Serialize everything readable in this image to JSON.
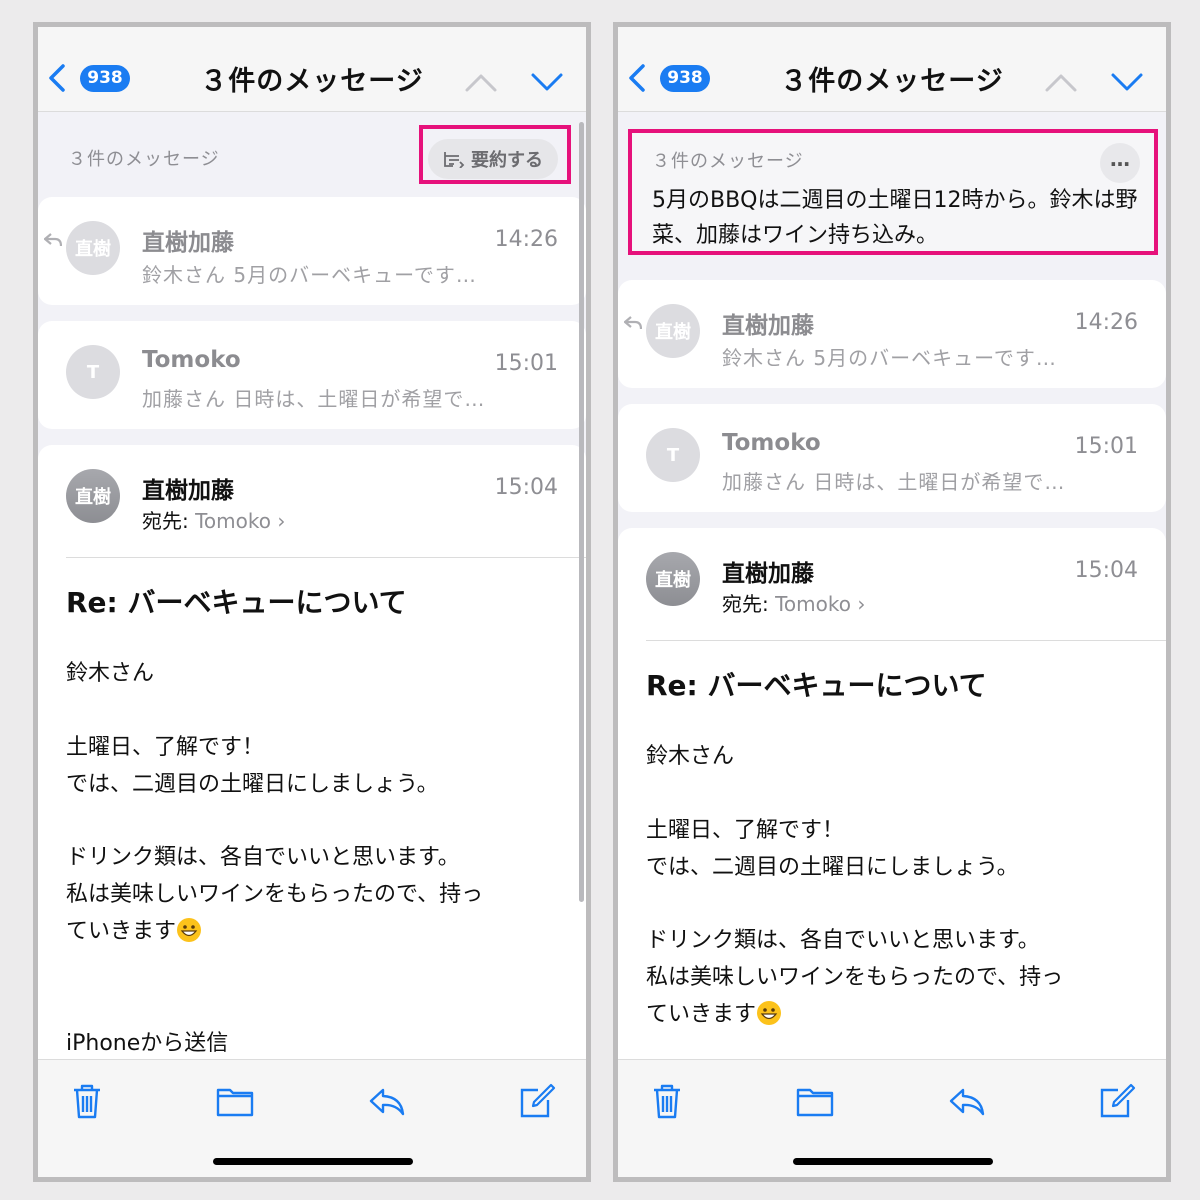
{
  "colors": {
    "accent": "#1a7cf2",
    "highlight": "#e6117b"
  },
  "nav": {
    "badge": "938",
    "title": "３件のメッセージ"
  },
  "thread": {
    "label": "３件のメッセージ",
    "summarize_label": "要約する"
  },
  "summary": {
    "label": "３件のメッセージ",
    "more": "…",
    "text": "5月のBBQは二週目の土曜日12時から。鈴木は野菜、加藤はワイン持ち込み。"
  },
  "messages": [
    {
      "avatar": "直樹",
      "sender": "直樹加藤",
      "time": "14:26",
      "preview": "鈴木さん 5月のバーベキューです…"
    },
    {
      "avatar": "T",
      "sender": "Tomoko",
      "time": "15:01",
      "preview": "加藤さん 日時は、土曜日が希望で…"
    }
  ],
  "open_message": {
    "avatar": "直樹",
    "sender": "直樹加藤",
    "time": "15:04",
    "to_label": "宛先:",
    "to_name": "Tomoko",
    "to_chevron": "›",
    "subject": "Re: バーベキューについて",
    "greeting": "鈴木さん",
    "para1": "土曜日、了解です！\nでは、二週目の土曜日にしましょう。",
    "para2": "ドリンク類は、各自でいいと思います。\n私は美味しいワインをもらったので、持っ\nていきます",
    "signature": "iPhoneから送信"
  },
  "toolbar": {
    "icons": [
      "trash-icon",
      "folder-icon",
      "reply-icon",
      "compose-icon"
    ]
  }
}
